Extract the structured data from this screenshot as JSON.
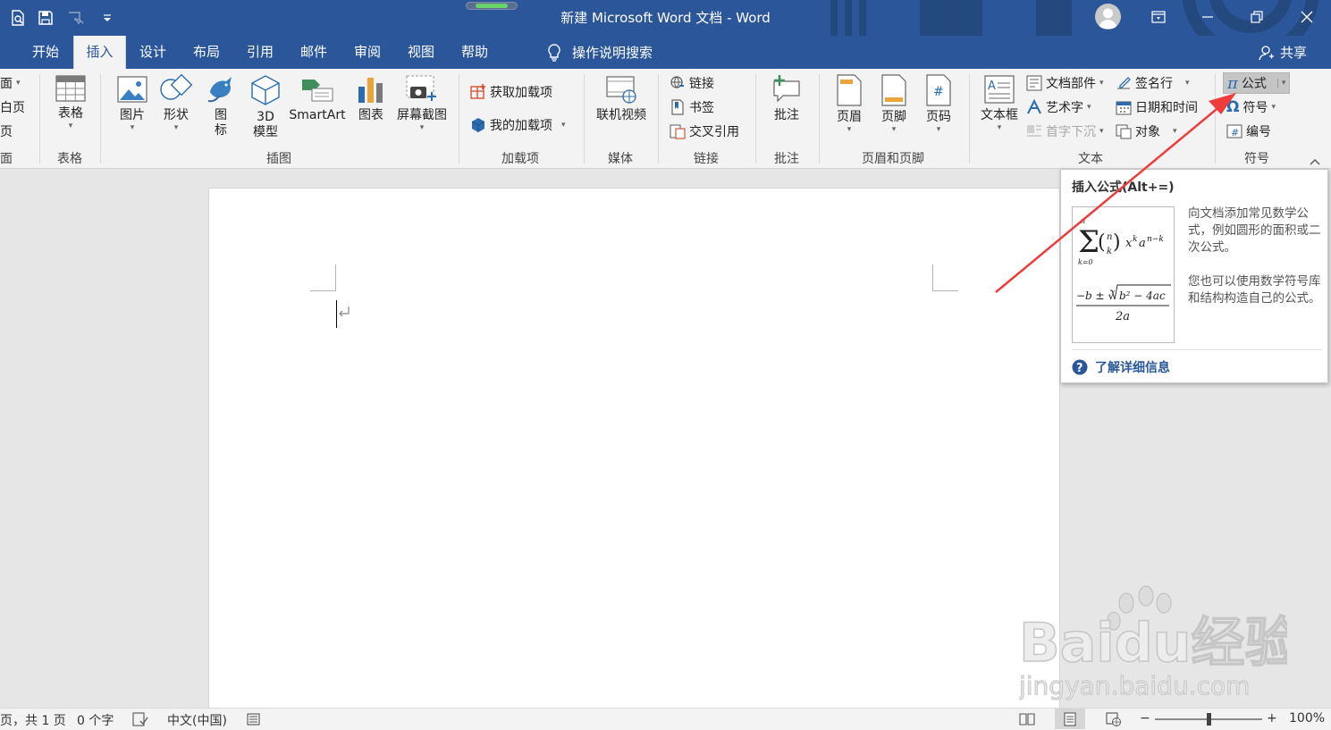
{
  "window": {
    "title": "新建 Microsoft Word 文档  -  Word",
    "accent_color": "#2b579a"
  },
  "quick_access": [
    "print-preview-icon",
    "save-icon",
    "touch-mode-icon",
    "customize-qat-icon"
  ],
  "tabs": [
    {
      "label": "开始",
      "active": false
    },
    {
      "label": "插入",
      "active": true
    },
    {
      "label": "设计",
      "active": false
    },
    {
      "label": "布局",
      "active": false
    },
    {
      "label": "引用",
      "active": false
    },
    {
      "label": "邮件",
      "active": false
    },
    {
      "label": "审阅",
      "active": false
    },
    {
      "label": "视图",
      "active": false
    },
    {
      "label": "帮助",
      "active": false
    }
  ],
  "tell_me": {
    "label": "操作说明搜索"
  },
  "share": {
    "label": "共享"
  },
  "ribbon": {
    "pages": {
      "items": [
        "面",
        "白页",
        "页"
      ],
      "label": "面"
    },
    "tables": {
      "table_label": "表格",
      "group_label": "表格"
    },
    "illustrations": {
      "picture_label": "图片",
      "shapes_label": "形状",
      "icons_label": "图\n标",
      "model3d_label": "3D\n模型",
      "smartart_label": "SmartArt",
      "chart_label": "图表",
      "screenshot_label": "屏幕截图",
      "group_label": "插图"
    },
    "addins": {
      "get_label": "获取加载项",
      "my_label": "我的加载项",
      "group_label": "加载项"
    },
    "media": {
      "video_label": "联机视频",
      "group_label": "媒体"
    },
    "links": {
      "link_label": "链接",
      "bookmark_label": "书签",
      "crossref_label": "交叉引用",
      "group_label": "链接"
    },
    "comments": {
      "comment_label": "批注",
      "group_label": "批注"
    },
    "header_footer": {
      "header_label": "页眉",
      "footer_label": "页脚",
      "pagenum_label": "页码",
      "group_label": "页眉和页脚"
    },
    "text": {
      "textbox_label": "文本框",
      "quickparts_label": "文档部件",
      "wordart_label": "艺术字",
      "dropcap_label": "首字下沉",
      "signature_label": "签名行",
      "datetime_label": "日期和时间",
      "object_label": "对象",
      "group_label": "文本"
    },
    "symbols": {
      "equation_label": "公式",
      "symbol_label": "符号",
      "number_label": "编号",
      "group_label": "符号"
    }
  },
  "tooltip": {
    "title": "插入公式(Alt+=)",
    "description_1": "向文档添加常见数学公式，例如圆形的面积或二次公式。",
    "description_2": "您也可以使用数学符号库和结构构造自己的公式。",
    "link_label": "了解详细信息"
  },
  "statusbar": {
    "page_info": "页，共 1 页",
    "word_count": "0 个字",
    "language": "中文(中国)",
    "zoom_minus": "−",
    "zoom_plus": "+",
    "zoom": "100%",
    "zoom_fraction": 0.5
  },
  "watermark": {
    "brand": "Baidu经验",
    "url": "jingyan.baidu.com"
  }
}
